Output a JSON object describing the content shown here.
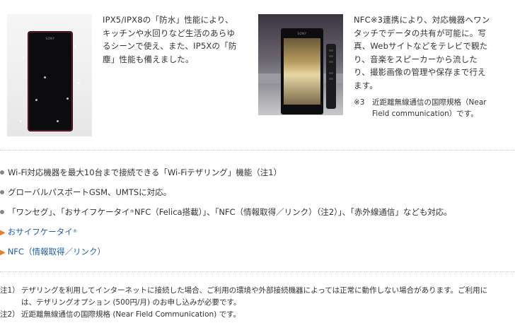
{
  "features": [
    {
      "lines": [
        "IPX5/IPX8の「防水」性能により、",
        "キッチンや水回りなど生活のあらゆ",
        "るシーンで使え、また、IP5Xの「防",
        "塵」性能も備えました。"
      ],
      "photo_brand": "SONY"
    },
    {
      "lines": [
        "NFC※3連携により、対応機器へワン",
        "タッチでデータの共有が可能に。写",
        "真、Webサイトなどをテレビで観た",
        "り、音楽をスピーカーから流した",
        "り、撮影画像の管理や保存まで行え",
        "ます。"
      ],
      "photo_brand": "SONY",
      "footnote_mark": "※3",
      "footnote_lines": [
        "近距離無線通信の国際規格（Near",
        "Field communication）です。"
      ]
    }
  ],
  "bullets": [
    "Wi-Fi対応機器を最大10台まで接続できる「Wi-Fiテザリング」機能（注1）",
    "グローバルパスポートGSM、UMTSに対応。",
    {
      "pre": "「ワンセグ」、「おサイフケータイ",
      "mark": "®",
      "post": "NFC（Felica搭載）」、「NFC（情報取得／リンク）（注2）」、「赤外線通信」なども対応。"
    }
  ],
  "links": [
    {
      "arrow": "▶",
      "label": "おサイフケータイ",
      "mark": "®"
    },
    {
      "arrow": "▶",
      "label": "NFC（情報取得／リンク）"
    }
  ],
  "notes": [
    {
      "mark": "注1）",
      "lines": [
        "テザリングを利用してインターネットに接続した場合、ご利用の環境や外部接続機器によっては正常に動作しない場合があります。ご利用に",
        "は、テザリングオプション (500円/月) のお申し込みが必要です。"
      ]
    },
    {
      "mark": "注2）",
      "lines": [
        "近距離無線通信の国際規格 (Near Field Communication) です。"
      ]
    }
  ]
}
